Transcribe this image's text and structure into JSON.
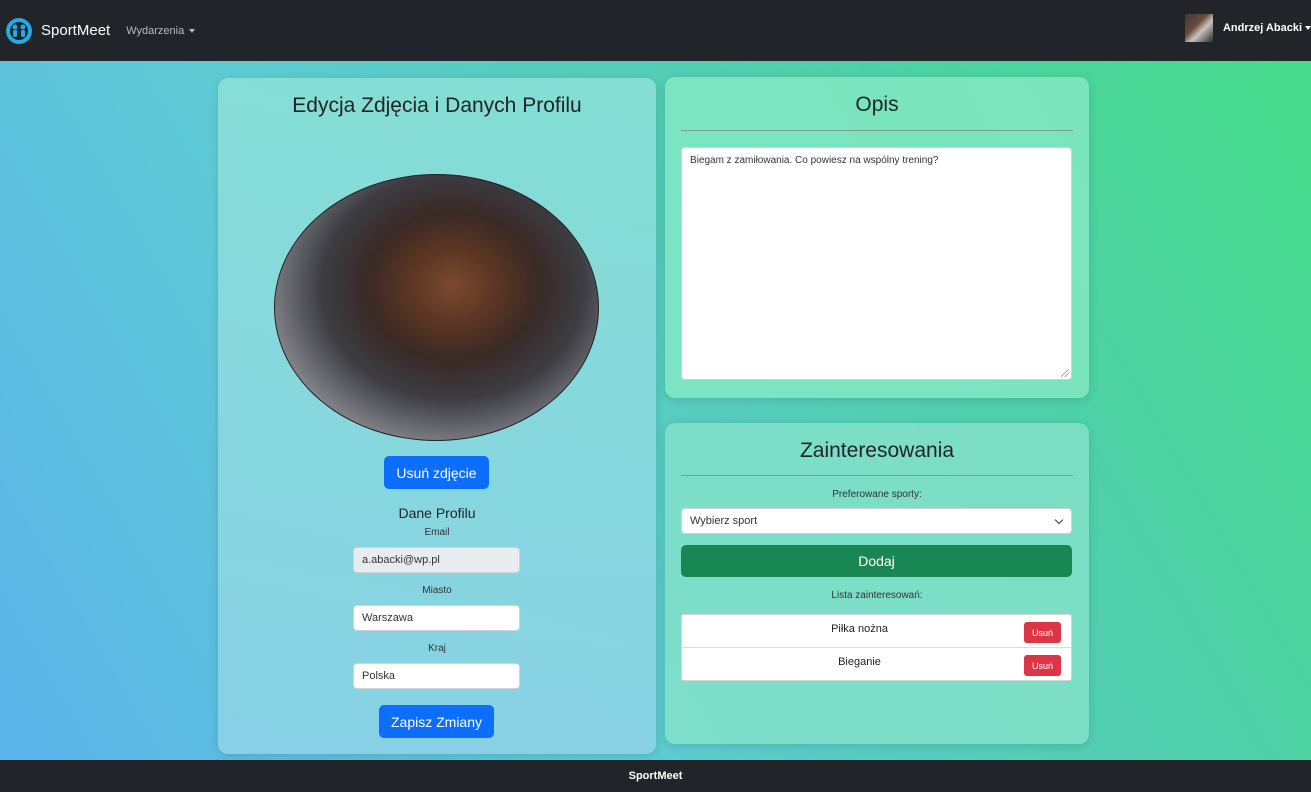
{
  "navbar": {
    "brand": "SportMeet",
    "events_menu": "Wydarzenia",
    "user_name": "Andrzej Abacki"
  },
  "profile_card": {
    "title": "Edycja Zdjęcia i Danych Profilu",
    "remove_photo_label": "Usuń zdjęcie",
    "section_title": "Dane Profilu",
    "email_label": "Email",
    "email_value": "a.abacki@wp.pl",
    "city_label": "Miasto",
    "city_value": "Warszawa",
    "country_label": "Kraj",
    "country_value": "Polska",
    "save_label": "Zapisz Zmiany"
  },
  "description_card": {
    "title": "Opis",
    "text": "Biegam z zamiłowania. Co powiesz na wspólny trening?"
  },
  "interests_card": {
    "title": "Zainteresowania",
    "preferred_label": "Preferowane sporty:",
    "select_value": "Wybierz sport",
    "add_label": "Dodaj",
    "list_label": "Lista zainteresowań:",
    "items": [
      {
        "name": "Piłka nożna",
        "remove_label": "Usuń"
      },
      {
        "name": "Bieganie",
        "remove_label": "Usuń"
      }
    ]
  },
  "footer": {
    "text": "SportMeet"
  },
  "colors": {
    "navbar": "#212529",
    "primary": "#0d6efd",
    "success": "#198754",
    "danger": "#dc3545"
  },
  "icons": {
    "brand_logo": "sportmeet-logo-icon"
  }
}
